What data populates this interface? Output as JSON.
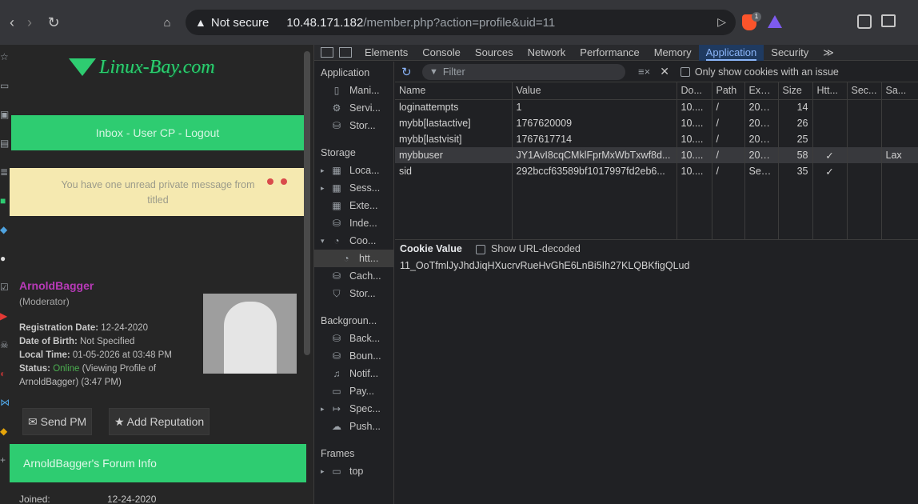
{
  "browser": {
    "security_label": "Not secure",
    "url_host": "10.48.171.182",
    "url_path": "/member.php?action=profile&uid=11",
    "brave_badge": "1"
  },
  "page": {
    "logo_text": "Linux-Bay.com",
    "navbar": "Inbox - User CP - Logout",
    "pm_notice_line1": "You have one unread private message from",
    "pm_notice_line2": "titled",
    "profile_name": "ArnoldBagger",
    "profile_role": "(Moderator)",
    "rows": [
      {
        "label": "Registration Date:",
        "value": "12-24-2020"
      },
      {
        "label": "Date of Birth:",
        "value": "Not Specified"
      },
      {
        "label": "Local Time:",
        "value": "01-05-2026 at 03:48 PM"
      },
      {
        "label": "Status:",
        "value_on": "Online",
        "value": "(Viewing Profile of"
      },
      {
        "label": "",
        "value": "ArnoldBagger) (3:47 PM)"
      }
    ],
    "send_pm": "Send PM",
    "add_reputation": "Add Reputation",
    "forum_info": "ArnoldBagger's Forum Info",
    "joined_label": "Joined:",
    "joined_value": "12-24-2020"
  },
  "devtools": {
    "tabs": [
      "Elements",
      "Console",
      "Sources",
      "Network",
      "Performance",
      "Memory",
      "Application",
      "Security"
    ],
    "active_tab": "Application",
    "more": "≫",
    "sidebar": {
      "application_header": "Application",
      "application_items": [
        "Mani...",
        "Servi...",
        "Stor..."
      ],
      "storage_header": "Storage",
      "storage_items": [
        "Loca...",
        "Sess...",
        "Exte...",
        "Inde...",
        "Coo...",
        "htt...",
        "Cach...",
        "Stor..."
      ],
      "background_header": "Backgroun...",
      "background_items": [
        "Back...",
        "Boun...",
        "Notif...",
        "Pay...",
        "Spec...",
        "Push..."
      ],
      "frames_header": "Frames",
      "frames_items": [
        "top"
      ]
    },
    "filter_placeholder": "Filter",
    "only_issues_label": "Only show cookies with an issue",
    "columns": [
      "Name",
      "Value",
      "Do...",
      "Path",
      "Exp...",
      "Size",
      "Htt...",
      "Sec...",
      "Sa..."
    ],
    "cookies": [
      {
        "name": "loginattempts",
        "value": "1",
        "domain": "10....",
        "path": "/",
        "expires": "202...",
        "size": "14",
        "http": "",
        "secure": "",
        "samesite": ""
      },
      {
        "name": "mybb[lastactive]",
        "value": "1767620009",
        "domain": "10....",
        "path": "/",
        "expires": "202...",
        "size": "26",
        "http": "",
        "secure": "",
        "samesite": ""
      },
      {
        "name": "mybb[lastvisit]",
        "value": "1767617714",
        "domain": "10....",
        "path": "/",
        "expires": "202...",
        "size": "25",
        "http": "",
        "secure": "",
        "samesite": ""
      },
      {
        "name": "mybbuser",
        "value": "JY1AvI8cqCMklFprMxWbTxwf8d...",
        "domain": "10....",
        "path": "/",
        "expires": "202...",
        "size": "58",
        "http": "✓",
        "secure": "",
        "samesite": "Lax"
      },
      {
        "name": "sid",
        "value": "292bccf63589bf1017997fd2eb6...",
        "domain": "10....",
        "path": "/",
        "expires": "Ses...",
        "size": "35",
        "http": "✓",
        "secure": "",
        "samesite": ""
      }
    ],
    "cookie_value_title": "Cookie Value",
    "show_url_decoded": "Show URL-decoded",
    "cookie_value": "11_OoTfmlJyJhdJiqHXucrvRueHvGhE6LnBi5Ih27KLQBKfigQLud"
  }
}
